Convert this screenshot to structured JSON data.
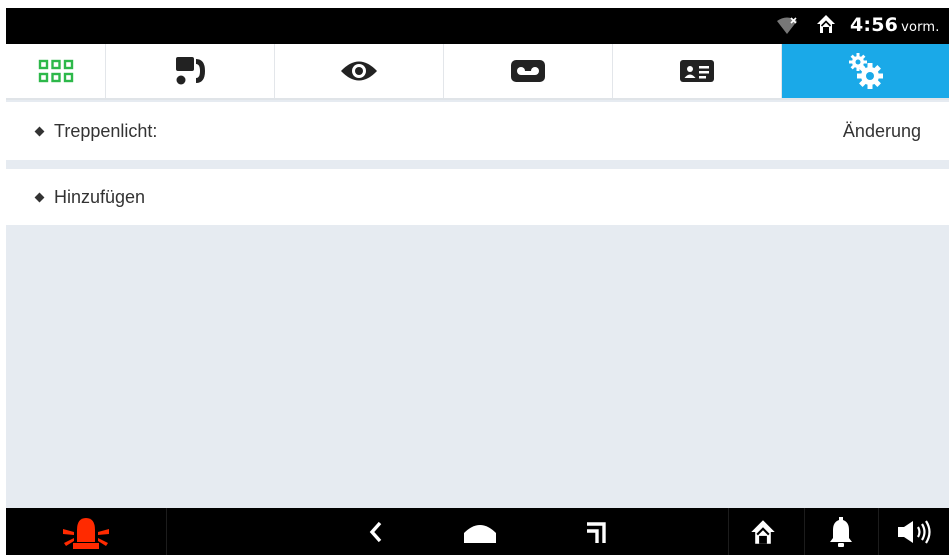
{
  "status_bar": {
    "time": "4:56",
    "ampm": "vorm.",
    "icons": [
      "wifi-off-icon",
      "home-status-icon"
    ]
  },
  "tabs": [
    {
      "name": "apps",
      "icon": "grid-icon",
      "color": "#2db84a",
      "active": false
    },
    {
      "name": "intercom",
      "icon": "door-phone-icon",
      "color": "#222222",
      "active": false
    },
    {
      "name": "monitor",
      "icon": "eye-icon",
      "color": "#222222",
      "active": false
    },
    {
      "name": "voicemail",
      "icon": "voicemail-icon",
      "color": "#222222",
      "active": false
    },
    {
      "name": "contacts",
      "icon": "contact-card-icon",
      "color": "#222222",
      "active": false
    },
    {
      "name": "settings",
      "icon": "gears-icon",
      "color": "#ffffff",
      "active": true
    }
  ],
  "list": {
    "items": [
      {
        "label": "Treppenlicht:",
        "action": "Änderung"
      },
      {
        "label": "Hinzufügen",
        "action": ""
      }
    ]
  },
  "nav_bar": {
    "icons": [
      "alarm-siren-icon",
      "back-icon",
      "home-icon",
      "recent-apps-icon",
      "home-automation-icon",
      "bell-icon",
      "volume-icon"
    ],
    "alarm_color": "#ff2a00"
  },
  "colors": {
    "accent": "#1aa9e8",
    "background": "#e6ebf1"
  }
}
